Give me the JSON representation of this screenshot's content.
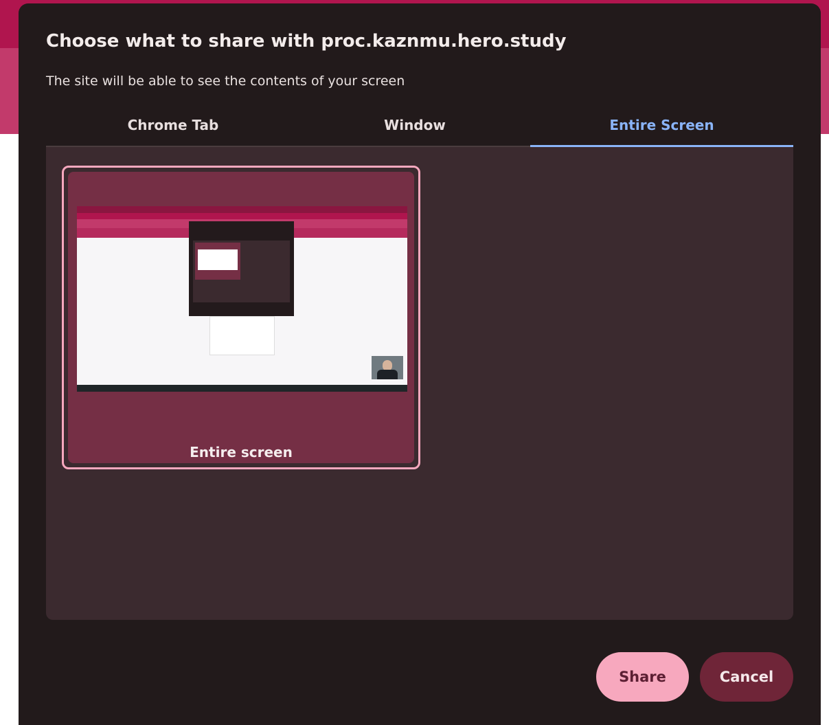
{
  "dialog": {
    "title": "Choose what to share with proc.kaznmu.hero.study",
    "subtitle": "The site will be able to see the contents of your screen"
  },
  "tabs": [
    {
      "label": "Chrome Tab",
      "active": false
    },
    {
      "label": "Window",
      "active": false
    },
    {
      "label": "Entire Screen",
      "active": true
    }
  ],
  "sources": [
    {
      "label": "Entire screen",
      "selected": true
    }
  ],
  "buttons": {
    "share_label": "Share",
    "cancel_label": "Cancel"
  },
  "colors": {
    "accent": "#8ab4f8",
    "primary_button": "#f7a8be",
    "secondary_button": "#6f2538",
    "dialog_background": "#221a1b",
    "panel_background": "#3b2a2f"
  }
}
